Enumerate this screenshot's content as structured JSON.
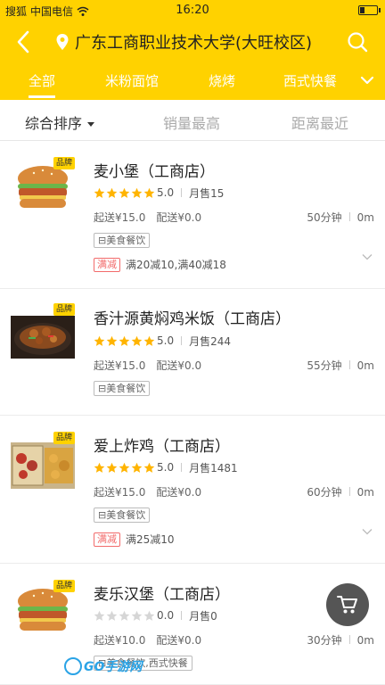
{
  "status_bar": {
    "carrier_left": "搜狐",
    "carrier": "中国电信",
    "time": "16:20",
    "battery_level": 0.3
  },
  "header": {
    "location": "广东工商职业技术大学(大旺校区)",
    "back_icon": "back-chevron-icon",
    "location_icon": "location-pin-icon",
    "search_icon": "search-icon"
  },
  "tabs": [
    {
      "label": "全部",
      "active": true
    },
    {
      "label": "米粉面馆",
      "active": false
    },
    {
      "label": "烧烤",
      "active": false
    },
    {
      "label": "西式快餐",
      "active": false
    }
  ],
  "sort": [
    {
      "label": "综合排序",
      "active": true
    },
    {
      "label": "销量最高",
      "active": false
    },
    {
      "label": "距离最近",
      "active": false
    }
  ],
  "shops": [
    {
      "name": "麦小堡（工商店）",
      "badge": "品牌",
      "rating": "5.0",
      "stars": 5,
      "monthly_sales": "月售15",
      "min_order": "起送¥15.0",
      "delivery_fee": "配送¥0.0",
      "time": "50分钟",
      "distance": "0m",
      "category_tag": "美食餐饮",
      "promo_label": "满减",
      "promo_text": "满20减10,满40减18",
      "image": "burger"
    },
    {
      "name": "香汁源黄焖鸡米饭（工商店）",
      "badge": "品牌",
      "rating": "5.0",
      "stars": 5,
      "monthly_sales": "月售244",
      "min_order": "起送¥15.0",
      "delivery_fee": "配送¥0.0",
      "time": "55分钟",
      "distance": "0m",
      "category_tag": "美食餐饮",
      "promo_label": "",
      "promo_text": "",
      "image": "braised-chicken"
    },
    {
      "name": "爱上炸鸡（工商店）",
      "badge": "品牌",
      "rating": "5.0",
      "stars": 5,
      "monthly_sales": "月售1481",
      "min_order": "起送¥15.0",
      "delivery_fee": "配送¥0.0",
      "time": "60分钟",
      "distance": "0m",
      "category_tag": "美食餐饮",
      "promo_label": "满减",
      "promo_text": "满25减10",
      "image": "fried-chicken"
    },
    {
      "name": "麦乐汉堡（工商店）",
      "badge": "品牌",
      "rating": "0.0",
      "stars": 0,
      "monthly_sales": "月售0",
      "min_order": "起送¥10.0",
      "delivery_fee": "配送¥0.0",
      "time": "30分钟",
      "distance": "0m",
      "category_tag": "美食餐饮,西式快餐",
      "promo_label": "",
      "promo_text": "",
      "image": "burger"
    }
  ],
  "cart_icon": "shopping-cart-icon",
  "watermark": "GO手游网",
  "colors": {
    "brand_yellow": "#ffd200",
    "star_yellow": "#ffb400",
    "promo_red": "#f26b6b"
  }
}
